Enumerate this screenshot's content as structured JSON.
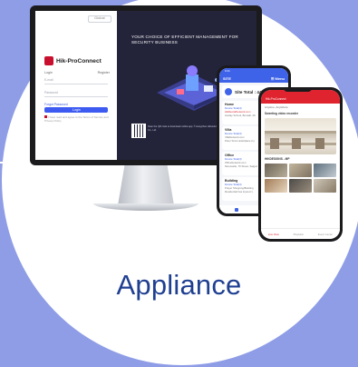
{
  "caption": "Appliance",
  "colors": {
    "background": "#8e9de6",
    "caption": "#1f3f91",
    "accent_blue": "#3f63e8",
    "accent_red": "#e0242f",
    "brand_red": "#c8102e"
  },
  "monitor": {
    "top_button": "Global",
    "brand_name": "Hik-ProConnect",
    "tabs": [
      "Login",
      "Register"
    ],
    "fields": [
      "E-mail",
      "Password"
    ],
    "forgot": "Forgot Password",
    "login_button": "Login",
    "remember": "I have read and agree to the Terms of Service and Privacy Policy",
    "headline": "YOUR CHOICE OF EFFICIENT MANAGEMENT FOR SECURITY BUSINESS",
    "qr_text": "Scan the QR code to download mobile app. © Hangzhou Hikvision Digital Technology Co., Ltd."
  },
  "phone1": {
    "status": "9:41",
    "title": "SITE",
    "menu": "☰ Menu",
    "site_total": "Site Total : 440",
    "cards": [
      {
        "title": "Home",
        "lines": [
          "Device Total(4)",
          "HikRentalNetwork.com",
          "Huiday School, Bonsall, 4S"
        ]
      },
      {
        "title": "Villa",
        "lines": [
          "Device Total(3)",
          "VillaNetwork.com",
          "Peter Sims Hotel/place (1)"
        ]
      },
      {
        "title": "Office",
        "lines": [
          "Device Total(3)",
          "OfficeNetwork.com",
          "Ninecastle, 76 Street, Saigon"
        ]
      },
      {
        "title": "Building",
        "lines": [
          "Device Total(3)",
          "Prayer Shopping/Building",
          "Residential has Injured 1"
        ]
      }
    ]
  },
  "phone2": {
    "header": "Hik-ProConnect",
    "subtitle": "Anytime, Anywhere",
    "section1": "Sweeting video recorder",
    "section2": "HIKDESIGNS - MP",
    "nav": [
      "Live View",
      "Playback",
      "Event Center"
    ]
  }
}
